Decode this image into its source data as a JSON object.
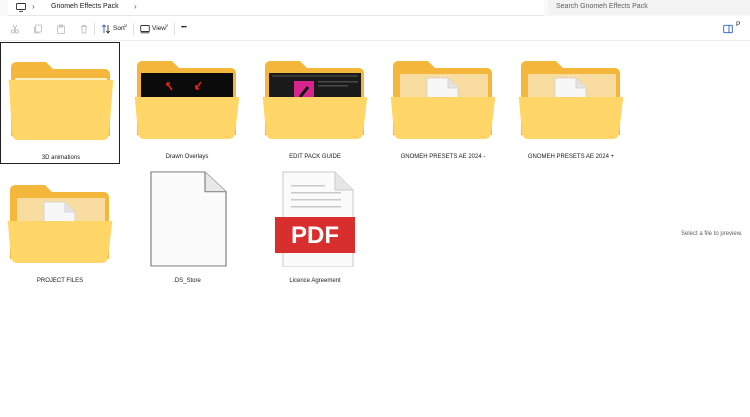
{
  "address": {
    "breadcrumb_sep_1": "›",
    "current_folder": "Gnomeh Effects Pack",
    "breadcrumb_sep_2": "›",
    "icon": "computer-icon"
  },
  "search": {
    "placeholder": "Search Gnomeh Effects Pack"
  },
  "toolbar": {
    "sort_label": "Sort",
    "view_label": "View",
    "more_label": "•••",
    "chevron": "˅",
    "preview_label": "P"
  },
  "items": [
    {
      "label": "3D animations",
      "icon": "folder-icon",
      "selected": true
    },
    {
      "label": "Drawn Overlays",
      "icon": "folder-with-preview-icon"
    },
    {
      "label": "EDIT PACK GUIDE",
      "icon": "folder-with-preview-icon"
    },
    {
      "label": "GNOMEH PRESETS AE 2024 -",
      "icon": "folder-with-document-icon"
    },
    {
      "label": "GNOMEH PRESETS AE 2024 +",
      "icon": "folder-with-document-icon"
    },
    {
      "label": "PROJECT FILES",
      "icon": "folder-with-document-icon"
    },
    {
      "label": ".DS_Store",
      "icon": "generic-file-icon"
    },
    {
      "label": "Licence Agreement",
      "icon": "pdf-file-icon",
      "badge": "PDF"
    }
  ],
  "preview": {
    "message": "Select a file to preview."
  },
  "colors": {
    "folder_back": "#F4B73C",
    "folder_front": "#FFD667",
    "pdf_red": "#D92E2E",
    "selection_border": "#202020"
  }
}
